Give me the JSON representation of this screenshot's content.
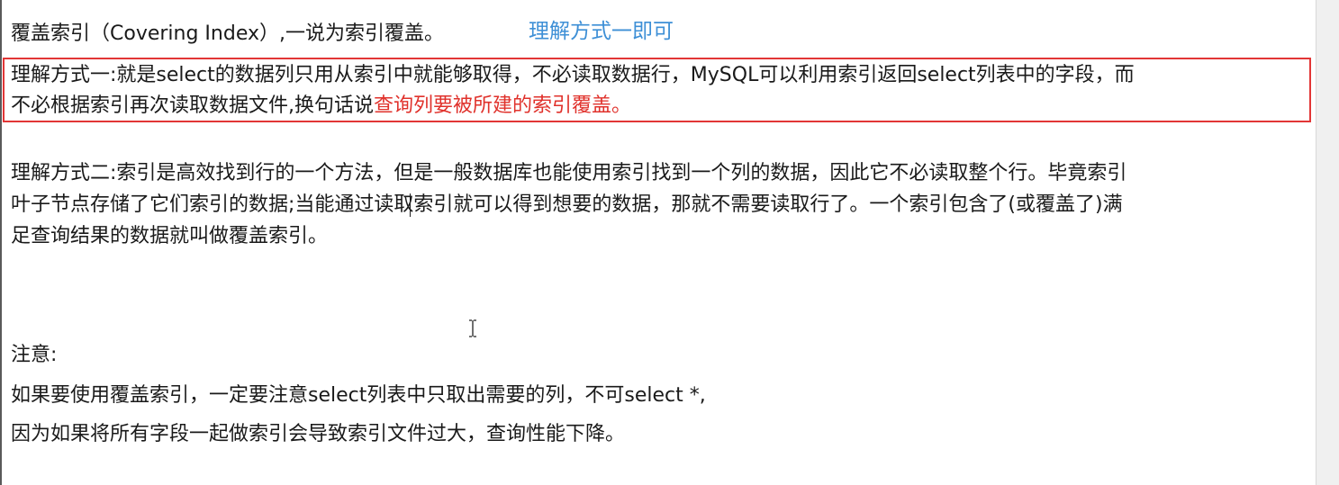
{
  "doc": {
    "title_line": "覆盖索引（Covering Index）,一说为索引覆盖。",
    "hint": "理解方式一即可",
    "way1_line1": "理解方式一:就是select的数据列只用从索引中就能够取得，不必读取数据行，MySQL可以利用索引返回select列表中的字段，而",
    "way1_line2_plain": "不必根据索引再次读取数据文件,换句话说",
    "way1_line2_red": "查询列要被所建的索引覆盖。",
    "way2_line1": "理解方式二:索引是高效找到行的一个方法，但是一般数据库也能使用索引找到一个列的数据，因此它不必读取整个行。毕竟索引",
    "way2_line2": "叶子节点存储了它们索引的数据;当能通过读取索引就可以得到想要的数据，那就不需要读取行了。一个索引包含了(或覆盖了)满",
    "way2_line3": "足查询结果的数据就叫做覆盖索引。",
    "note_label": "注意:",
    "note_line1": "如果要使用覆盖索引，一定要注意select列表中只取出需要的列，不可select *,",
    "note_line2": "因为如果将所有字段一起做索引会导致索引文件过大，查询性能下降。"
  },
  "colors": {
    "hint": "#3d8fd6",
    "highlight_border": "#e23636",
    "red_text": "#e0312b"
  },
  "icons": {
    "cursor": "ibeam-cursor-icon"
  }
}
